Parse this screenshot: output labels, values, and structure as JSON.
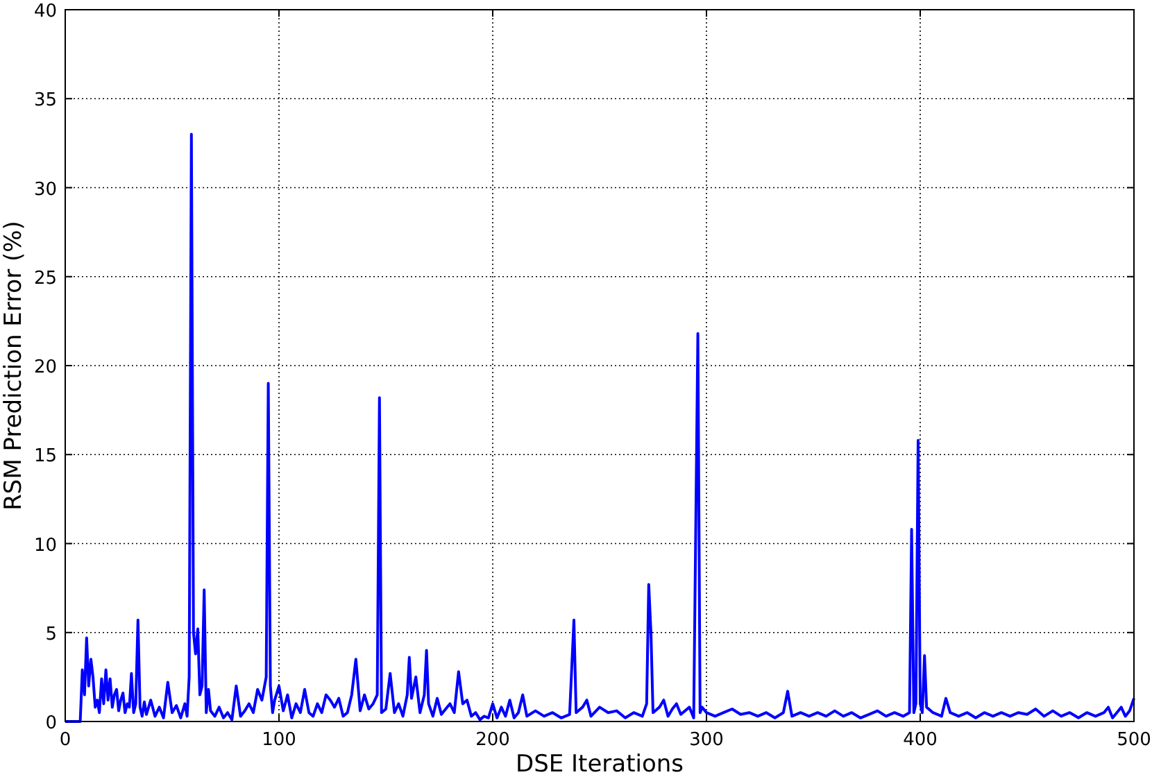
{
  "chart_data": {
    "type": "line",
    "xlabel": "DSE Iterations",
    "ylabel": "RSM Prediction Error (%)",
    "xlim": [
      0,
      500
    ],
    "ylim": [
      0,
      40
    ],
    "grid": true,
    "xticks": [
      0,
      100,
      200,
      300,
      400,
      500
    ],
    "yticks": [
      0,
      5,
      10,
      15,
      20,
      25,
      30,
      35,
      40
    ],
    "x": [
      0,
      5,
      7,
      8,
      9,
      10,
      11,
      12,
      13,
      14,
      15,
      16,
      17,
      18,
      19,
      20,
      21,
      22,
      23,
      24,
      25,
      26,
      27,
      28,
      29,
      30,
      31,
      32,
      33,
      34,
      35,
      36,
      37,
      38,
      40,
      42,
      44,
      46,
      48,
      50,
      52,
      54,
      56,
      57,
      58,
      59,
      60,
      61,
      62,
      63,
      64,
      65,
      66,
      67,
      68,
      70,
      72,
      74,
      76,
      78,
      80,
      82,
      84,
      86,
      88,
      90,
      92,
      94,
      95,
      96,
      97,
      98,
      100,
      102,
      104,
      106,
      108,
      110,
      112,
      114,
      116,
      118,
      120,
      122,
      124,
      126,
      128,
      130,
      132,
      134,
      136,
      138,
      140,
      142,
      144,
      146,
      147,
      148,
      150,
      152,
      154,
      156,
      158,
      160,
      161,
      162,
      164,
      166,
      168,
      169,
      170,
      172,
      174,
      176,
      178,
      180,
      182,
      184,
      186,
      188,
      190,
      192,
      194,
      196,
      198,
      200,
      202,
      204,
      206,
      208,
      210,
      212,
      214,
      216,
      220,
      224,
      228,
      232,
      236,
      238,
      239,
      242,
      244,
      246,
      250,
      254,
      258,
      262,
      266,
      270,
      272,
      273,
      274,
      275,
      278,
      280,
      282,
      284,
      286,
      288,
      292,
      294,
      296,
      297,
      298,
      300,
      304,
      308,
      312,
      316,
      320,
      324,
      328,
      332,
      336,
      338,
      340,
      344,
      348,
      352,
      356,
      360,
      364,
      368,
      372,
      376,
      380,
      384,
      388,
      392,
      395,
      396,
      397,
      398,
      399,
      400,
      401,
      402,
      403,
      406,
      410,
      412,
      414,
      418,
      422,
      426,
      430,
      434,
      438,
      442,
      446,
      450,
      454,
      458,
      462,
      466,
      470,
      474,
      478,
      482,
      486,
      488,
      490,
      492,
      494,
      496,
      498,
      500
    ],
    "series": [
      {
        "color": "#0000ff",
        "values": [
          0,
          0,
          0,
          2.9,
          1.5,
          4.7,
          2,
          3.5,
          2.5,
          0.8,
          1.2,
          0.5,
          2.4,
          1.0,
          2.9,
          1.2,
          2.4,
          0.8,
          1.5,
          1.8,
          0.6,
          1.2,
          1.6,
          0.5,
          1.0,
          0.8,
          2.7,
          0.5,
          1.0,
          5.7,
          0.8,
          0.3,
          1.1,
          0.4,
          1.2,
          0.3,
          0.8,
          0.2,
          2.2,
          0.5,
          0.9,
          0.2,
          1.0,
          0.3,
          2.5,
          33,
          5,
          3.8,
          5.2,
          1.5,
          2,
          7.4,
          0.5,
          1.8,
          0.6,
          0.3,
          0.8,
          0.2,
          0.5,
          0.1,
          2.0,
          0.3,
          0.6,
          1.0,
          0.5,
          1.8,
          1.2,
          2.5,
          19,
          2,
          0.5,
          1.2,
          2.0,
          0.6,
          1.5,
          0.2,
          1,
          0.5,
          1.8,
          0.5,
          0.3,
          1.0,
          0.5,
          1.5,
          1.2,
          0.8,
          1.3,
          0.3,
          0.5,
          1.5,
          3.5,
          0.6,
          1.5,
          0.7,
          1.0,
          1.5,
          18.2,
          0.5,
          0.7,
          2.7,
          0.5,
          1.0,
          0.3,
          1.5,
          3.6,
          1.3,
          2.5,
          0.5,
          1.5,
          4.0,
          1.0,
          0.3,
          1.3,
          0.4,
          0.7,
          1.0,
          0.5,
          2.8,
          1.0,
          1.2,
          0.3,
          0.5,
          0.1,
          0.3,
          0.2,
          1.0,
          0.2,
          0.8,
          0.3,
          1.2,
          0.2,
          0.5,
          1.5,
          0.3,
          0.6,
          0.3,
          0.5,
          0.2,
          0.4,
          5.7,
          0.5,
          0.8,
          1.2,
          0.3,
          0.8,
          0.5,
          0.6,
          0.2,
          0.5,
          0.3,
          1.0,
          7.7,
          5,
          0.5,
          0.8,
          1.2,
          0.3,
          0.7,
          1.0,
          0.4,
          0.8,
          0.2,
          21.8,
          0.5,
          0.8,
          0.5,
          0.3,
          0.5,
          0.7,
          0.4,
          0.5,
          0.3,
          0.5,
          0.2,
          0.5,
          1.7,
          0.3,
          0.5,
          0.3,
          0.5,
          0.3,
          0.6,
          0.3,
          0.5,
          0.2,
          0.4,
          0.6,
          0.3,
          0.5,
          0.3,
          0.5,
          10.8,
          0.5,
          1.0,
          15.8,
          1.0,
          0.5,
          3.7,
          0.8,
          0.5,
          0.3,
          1.3,
          0.5,
          0.3,
          0.5,
          0.2,
          0.5,
          0.3,
          0.5,
          0.3,
          0.5,
          0.4,
          0.7,
          0.3,
          0.6,
          0.3,
          0.5,
          0.2,
          0.5,
          0.3,
          0.5,
          0.8,
          0.2,
          0.5,
          0.8,
          0.3,
          0.6,
          1.3
        ]
      }
    ]
  }
}
